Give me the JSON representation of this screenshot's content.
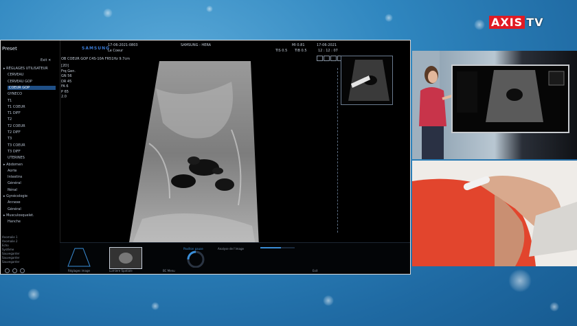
{
  "brand": {
    "logo_part1": "AXIS",
    "logo_part2": "TV",
    "accent": "#e01b24"
  },
  "ultrasound": {
    "preset_title": "Preset",
    "exit_label": "Exit",
    "presets": [
      {
        "label": "RÉGLAGES UTILISATEUR",
        "level": "group"
      },
      {
        "label": "CERVEAU",
        "level": "sub"
      },
      {
        "label": "CERVEAU GOP",
        "level": "sub"
      },
      {
        "label": "COEUR GOP",
        "level": "sub",
        "active": true
      },
      {
        "label": "GYNECO",
        "level": "sub"
      },
      {
        "label": "T1",
        "level": "sub"
      },
      {
        "label": "T1 COEUR",
        "level": "sub"
      },
      {
        "label": "T1 DIFF",
        "level": "sub"
      },
      {
        "label": "T2",
        "level": "sub"
      },
      {
        "label": "T2 COEUR",
        "level": "sub"
      },
      {
        "label": "T2 DIFF",
        "level": "sub"
      },
      {
        "label": "T3",
        "level": "sub"
      },
      {
        "label": "T3 COEUR",
        "level": "sub"
      },
      {
        "label": "T3 DIFF",
        "level": "sub"
      },
      {
        "label": "UTERINES",
        "level": "sub"
      },
      {
        "label": "Abdomen",
        "level": "group"
      },
      {
        "label": "Aorte",
        "level": "sub"
      },
      {
        "label": "Intestins",
        "level": "sub"
      },
      {
        "label": "Général",
        "level": "sub"
      },
      {
        "label": "Rénal",
        "level": "sub"
      },
      {
        "label": "Gynécologie",
        "level": "group"
      },
      {
        "label": "Annexe",
        "level": "sub"
      },
      {
        "label": "Général",
        "level": "sub"
      },
      {
        "label": "Musculosquelet.",
        "level": "group"
      },
      {
        "label": "Hanche",
        "level": "sub"
      }
    ],
    "bottom_list": [
      "Anomalie 1",
      "Anomalie 2",
      "Echo",
      "Système",
      "Sauvegarder",
      "Sauvegarder",
      "Sauvegarder"
    ],
    "manufacturer": "SAMSUNG",
    "date_top": "17-06-2021-0803",
    "study": "Le Coeur",
    "device": "SAMSUNG - HERA",
    "mi": "MI 0.81",
    "tis": "TIS 0.5",
    "tib": "TIB 0.5",
    "date_right": "17-06-2021",
    "time_right": "12 : 12 : 07",
    "probe_line": "OB COEUR GOP  C4S-10A  FR51Hz  9.7cm",
    "params": [
      "[2D]",
      "Frq  Gen.",
      "GN  56",
      "DR  45",
      "FA  6",
      "P  65",
      "2.0"
    ],
    "bottom_labels": {
      "probe": "Réglages image",
      "mode": "Lumiere Spatiale",
      "pause": "Pavillon pause",
      "review": "Analyse de l'image",
      "menu": "BC Menu",
      "end": "Exit"
    },
    "progress_percent": 60
  }
}
